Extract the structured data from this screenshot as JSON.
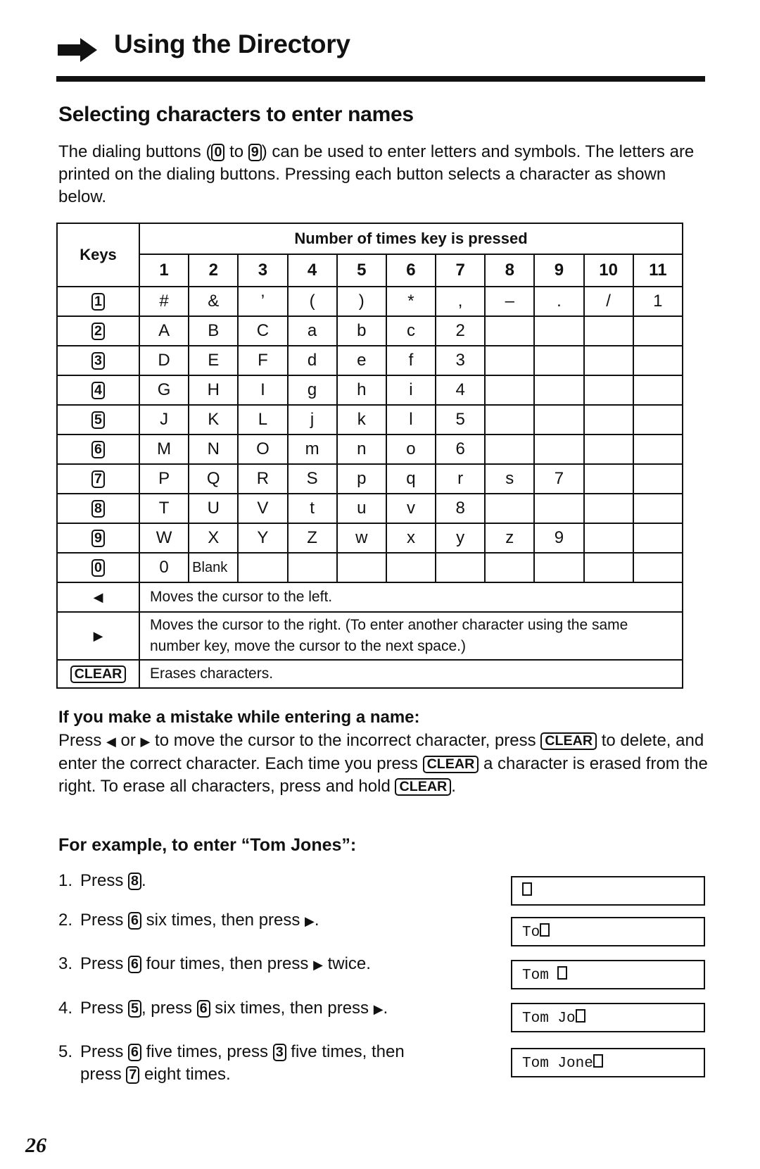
{
  "header": {
    "title": "Using the Directory",
    "icon": "arrow-right-icon"
  },
  "section": {
    "title": "Selecting characters to enter names",
    "intro": {
      "part1": "The dialing buttons (",
      "key_from": "0",
      "part2": " to ",
      "key_to": "9",
      "part3": ") can be used to enter letters and symbols. The letters are printed on the dialing buttons. Pressing each button selects a character as shown below."
    }
  },
  "table": {
    "keys_header": "Keys",
    "presses_header": "Number of times key is pressed",
    "press_counts": [
      "1",
      "2",
      "3",
      "4",
      "5",
      "6",
      "7",
      "8",
      "9",
      "10",
      "11"
    ],
    "rows": [
      {
        "key": "1",
        "chars": [
          "#",
          "&",
          "’",
          "(",
          ")",
          "*",
          ",",
          "–",
          ".",
          "/",
          "1"
        ]
      },
      {
        "key": "2",
        "chars": [
          "A",
          "B",
          "C",
          "a",
          "b",
          "c",
          "2",
          "",
          "",
          "",
          ""
        ]
      },
      {
        "key": "3",
        "chars": [
          "D",
          "E",
          "F",
          "d",
          "e",
          "f",
          "3",
          "",
          "",
          "",
          ""
        ]
      },
      {
        "key": "4",
        "chars": [
          "G",
          "H",
          "I",
          "g",
          "h",
          "i",
          "4",
          "",
          "",
          "",
          ""
        ]
      },
      {
        "key": "5",
        "chars": [
          "J",
          "K",
          "L",
          "j",
          "k",
          "l",
          "5",
          "",
          "",
          "",
          ""
        ]
      },
      {
        "key": "6",
        "chars": [
          "M",
          "N",
          "O",
          "m",
          "n",
          "o",
          "6",
          "",
          "",
          "",
          ""
        ]
      },
      {
        "key": "7",
        "chars": [
          "P",
          "Q",
          "R",
          "S",
          "p",
          "q",
          "r",
          "s",
          "7",
          "",
          ""
        ]
      },
      {
        "key": "8",
        "chars": [
          "T",
          "U",
          "V",
          "t",
          "u",
          "v",
          "8",
          "",
          "",
          "",
          ""
        ]
      },
      {
        "key": "9",
        "chars": [
          "W",
          "X",
          "Y",
          "Z",
          "w",
          "x",
          "y",
          "z",
          "9",
          "",
          ""
        ]
      },
      {
        "key": "0",
        "chars": [
          "0",
          "Blank",
          "",
          "",
          "",
          "",
          "",
          "",
          "",
          "",
          ""
        ]
      }
    ],
    "left_symbol": "◀",
    "left_desc": "Moves the cursor to the left.",
    "right_symbol": "▶",
    "right_desc": "Moves the cursor to the right. (To enter another character using the same number key, move the cursor to the next space.)",
    "clear_key": "CLEAR",
    "clear_desc": "Erases characters."
  },
  "mistake": {
    "heading": "If you make a mistake while entering a name:",
    "p1": "Press ",
    "left": "◀",
    "or": " or ",
    "right": "▶",
    "p2": " to move the cursor to the incorrect character, press ",
    "clear": "CLEAR",
    "p3": " to delete, and enter the correct character. Each time you press ",
    "p4": " a character is erased from the right. To erase all characters, press and hold ",
    "p5": "."
  },
  "example": {
    "heading": "For example, to enter “Tom Jones”:",
    "steps": [
      {
        "num": "1.",
        "a": "Press ",
        "k1": "8",
        "b": "."
      },
      {
        "num": "2.",
        "a": "Press ",
        "k1": "6",
        "b": " six times, then press ",
        "arrow": "▶",
        "c": "."
      },
      {
        "num": "3.",
        "a": "Press ",
        "k1": "6",
        "b": " four times, then press ",
        "arrow": "▶",
        "c": " twice."
      },
      {
        "num": "4.",
        "a": "Press ",
        "k1": "5",
        "b": ", press ",
        "k2": "6",
        "c": " six times, then press ",
        "arrow": "▶",
        "d": "."
      },
      {
        "num": "5.",
        "a": "Press ",
        "k1": "6",
        "b": " five times, press ",
        "k2": "3",
        "c": " five times, then",
        "line2a": "press ",
        "k3": "7",
        "line2b": " eight times."
      }
    ],
    "displays": [
      "",
      "To",
      "Tom ",
      "Tom Jo",
      "Tom Jone"
    ]
  },
  "page_number": "26"
}
